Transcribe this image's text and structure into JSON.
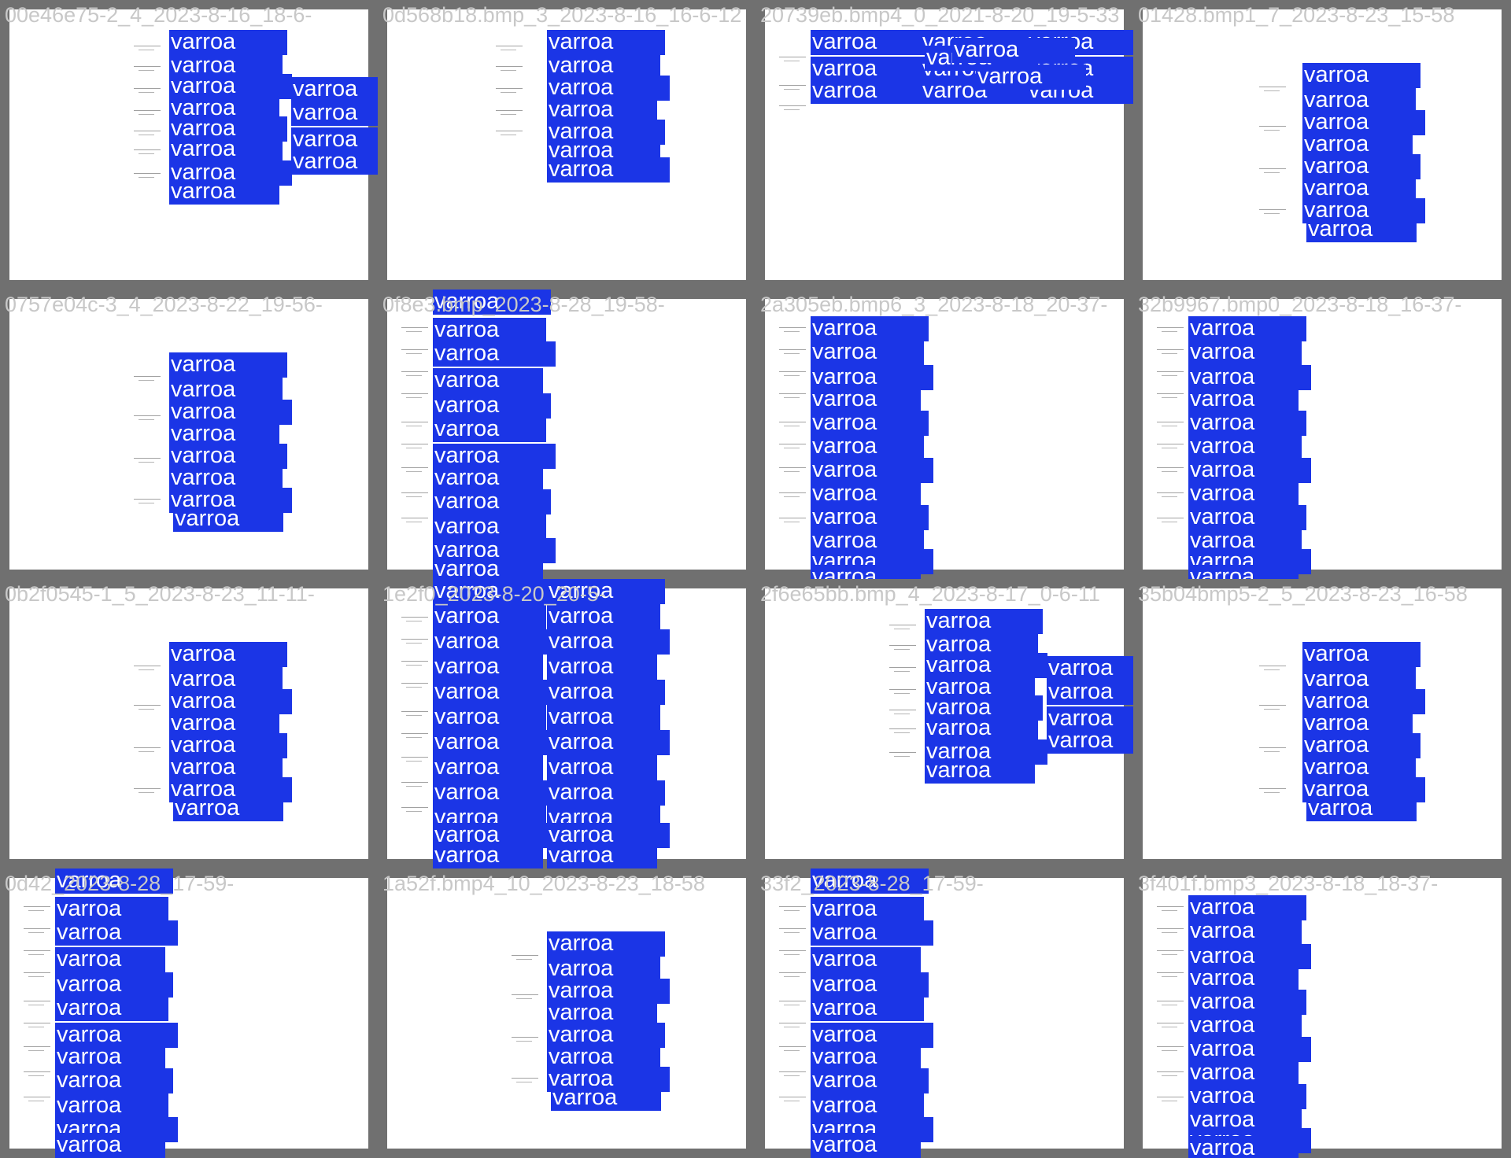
{
  "colors": {
    "frame": "#707070",
    "paper": "#ffffff",
    "label_bg": "#1b35e6",
    "label_text": "#ffffff",
    "title_text": "#c8c8c8"
  },
  "label_text": "varroa",
  "tiles": [
    {
      "title": "00e46e75-2_4_2023-8-16_18-6-",
      "detections": 12
    },
    {
      "title": "0d568b18.bmp_3_2023-8-16_16-6-12",
      "detections": 7
    },
    {
      "title": "20739eb.bmp4_0_2021-8-20_19-5-33",
      "detections": 12
    },
    {
      "title": "01428.bmp1_7_2023-8-23_15-58",
      "detections": 8
    },
    {
      "title": "0757e04c-3_4_2023-8-22_19-56-",
      "detections": 8
    },
    {
      "title": "0f8e3.bmp_2023-8-28_19-58-",
      "detections": 12
    },
    {
      "title": "2a305eb.bmp6_3_2023-8-18_20-37-",
      "detections": 12
    },
    {
      "title": "32b9967.bmp0_2023-8-18_16-37-",
      "detections": 12
    },
    {
      "title": "0b2f0545-1_5_2023-8-23_11-11-",
      "detections": 8
    },
    {
      "title": "1e2f0_2023-8-20_20-5-",
      "detections": 24
    },
    {
      "title": "2f6e65bb.bmp_4_2023-8-17_0-6-11",
      "detections": 12
    },
    {
      "title": "35b04bmp5-2_5_2023-8-23_16-58",
      "detections": 8
    },
    {
      "title": "0d42_2023-8-28_17-59-",
      "detections": 12
    },
    {
      "title": "1a52f.bmp4_10_2023-8-23_18-58",
      "detections": 8
    },
    {
      "title": "33f2_2023-8-28_17-59-",
      "detections": 12
    },
    {
      "title": "3f401f.bmp3_2023-8-18_18-37-",
      "detections": 12
    }
  ]
}
